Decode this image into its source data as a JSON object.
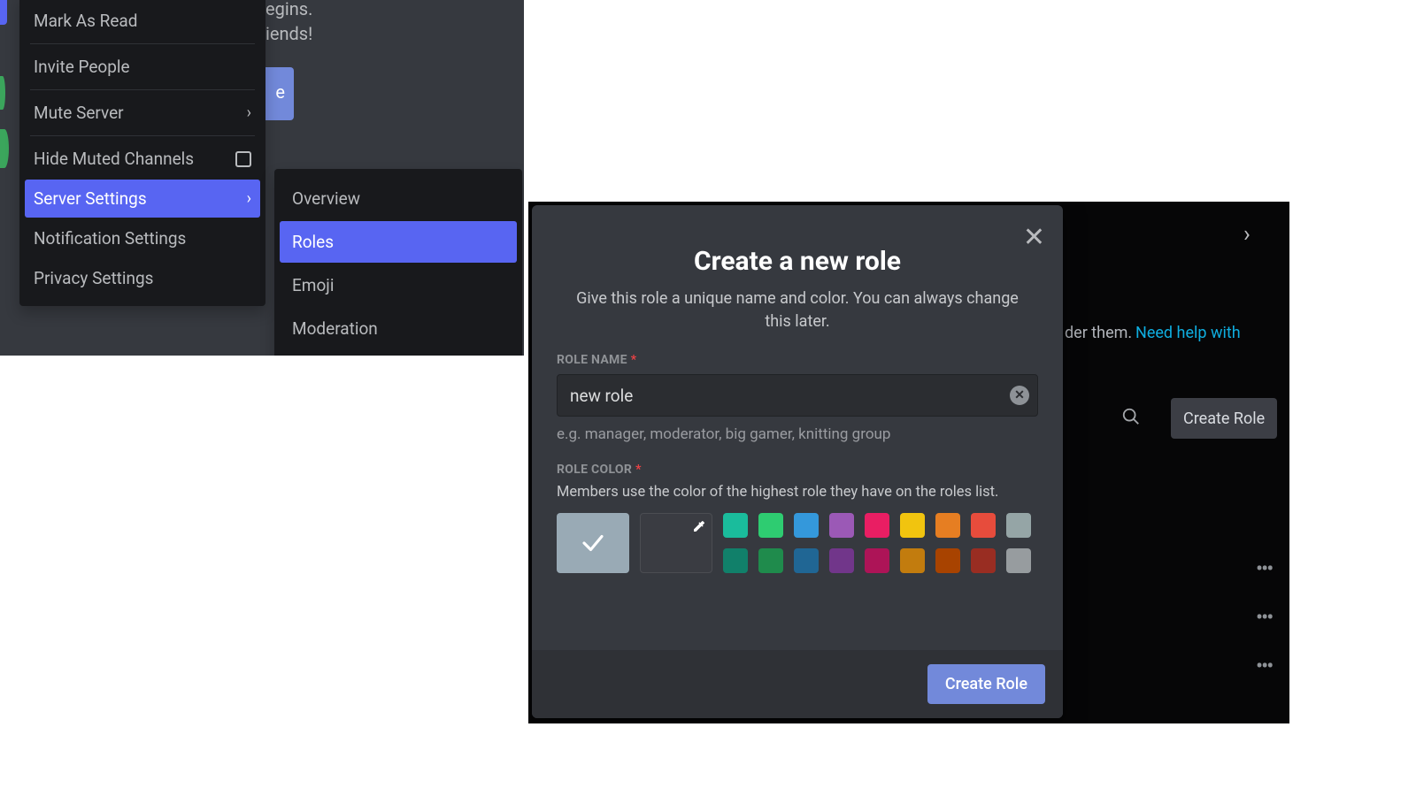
{
  "context_menu": {
    "items": [
      {
        "label": "Mark As Read",
        "chevron": false,
        "checkbox": false
      },
      {
        "label": "Invite People",
        "chevron": false,
        "checkbox": false
      },
      {
        "label": "Mute Server",
        "chevron": true,
        "checkbox": false
      },
      {
        "label": "Hide Muted Channels",
        "chevron": false,
        "checkbox": true
      },
      {
        "label": "Server Settings",
        "chevron": true,
        "checkbox": false,
        "active": true
      },
      {
        "label": "Notification Settings",
        "chevron": false,
        "checkbox": false
      },
      {
        "label": "Privacy Settings",
        "chevron": false,
        "checkbox": false
      }
    ]
  },
  "sub_menu": {
    "items": [
      {
        "label": "Overview"
      },
      {
        "label": "Roles",
        "active": true
      },
      {
        "label": "Emoji"
      },
      {
        "label": "Moderation"
      }
    ]
  },
  "bg_fragments": {
    "line1": "egins.",
    "line2": "iends!",
    "btn_letter": "e"
  },
  "right_bg": {
    "text_frag": "der them.",
    "link_frag": "Need help with",
    "create_role_btn": "Create Role"
  },
  "modal": {
    "title": "Create a new role",
    "description": "Give this role a unique name and color. You can always change this later.",
    "name_label": "Role Name",
    "name_value": "new role",
    "name_hint": "e.g. manager, moderator, big gamer, knitting group",
    "color_label": "Role Color",
    "color_desc": "Members use the color of the highest role they have on the roles list.",
    "default_color": "#99aab5",
    "swatch_rows": [
      [
        "#1abc9c",
        "#2ecc71",
        "#3498db",
        "#9b59b6",
        "#e91e63",
        "#f1c40f",
        "#e67e22",
        "#e74c3c",
        "#95a5a6"
      ],
      [
        "#11806a",
        "#1f8b4c",
        "#206694",
        "#71368a",
        "#ad1457",
        "#c27c0e",
        "#a84300",
        "#992d22",
        "#979c9f"
      ]
    ],
    "create_btn": "Create Role"
  }
}
